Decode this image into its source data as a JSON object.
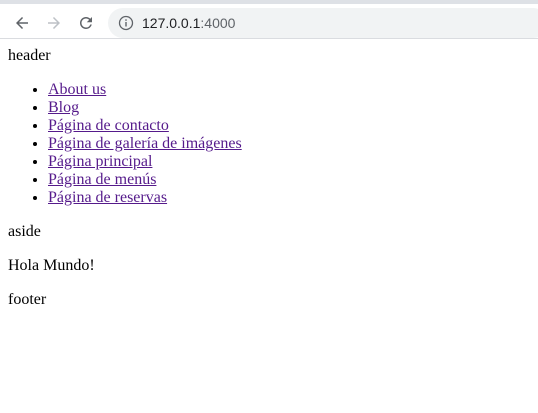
{
  "browser": {
    "url_host": "127.0.0.1",
    "url_port": ":4000"
  },
  "page": {
    "header_text": "header",
    "nav_links": [
      "About us",
      "Blog",
      "Página de contacto",
      "Página de galería de imágenes",
      "Página principal",
      "Página de menús",
      "Página de reservas"
    ],
    "aside_text": "aside",
    "main_text": "Hola Mundo!",
    "footer_text": "footer"
  },
  "colors": {
    "visited_link": "#551a8b",
    "omnibox_bg": "#f1f3f4",
    "icon": "#5f6368"
  }
}
